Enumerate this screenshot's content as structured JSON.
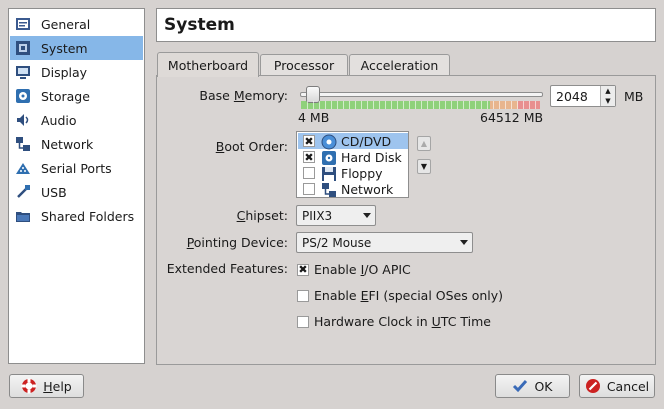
{
  "sidebar": {
    "items": [
      {
        "label": "General",
        "icon": "general-icon"
      },
      {
        "label": "System",
        "icon": "system-chip-icon",
        "selected": true
      },
      {
        "label": "Display",
        "icon": "display-monitor-icon"
      },
      {
        "label": "Storage",
        "icon": "storage-disk-icon"
      },
      {
        "label": "Audio",
        "icon": "audio-speaker-icon"
      },
      {
        "label": "Network",
        "icon": "network-icon"
      },
      {
        "label": "Serial Ports",
        "icon": "serial-port-icon"
      },
      {
        "label": "USB",
        "icon": "usb-icon"
      },
      {
        "label": "Shared Folders",
        "icon": "shared-folder-icon"
      }
    ]
  },
  "header": {
    "title": "System"
  },
  "tabs": [
    {
      "label": "Motherboard",
      "active": true
    },
    {
      "label": "Processor",
      "active": false
    },
    {
      "label": "Acceleration",
      "active": false
    }
  ],
  "motherboard": {
    "base_memory": {
      "label_pre": "Base ",
      "label_u": "M",
      "label_post": "emory:",
      "value": "2048",
      "unit": "MB",
      "min_label": "4 MB",
      "max_label": "64512 MB",
      "slider_fraction": 0.03
    },
    "boot_order": {
      "label_pre": "",
      "label_u": "B",
      "label_post": "oot Order:",
      "items": [
        {
          "label": "CD/DVD",
          "checked": true,
          "selected": true,
          "icon": "cd-dvd-icon"
        },
        {
          "label": "Hard Disk",
          "checked": true,
          "selected": false,
          "icon": "hard-disk-icon"
        },
        {
          "label": "Floppy",
          "checked": false,
          "selected": false,
          "icon": "floppy-icon"
        },
        {
          "label": "Network",
          "checked": false,
          "selected": false,
          "icon": "network-icon"
        }
      ]
    },
    "chipset": {
      "label_pre": "",
      "label_u": "C",
      "label_post": "hipset:",
      "value": "PIIX3"
    },
    "pointing_device": {
      "label_pre": "",
      "label_u": "P",
      "label_post": "ointing Device:",
      "value": "PS/2 Mouse"
    },
    "extended_features": {
      "label": "Extended Features:",
      "items": [
        {
          "pre": "Enable ",
          "u": "I",
          "post": "/O APIC",
          "checked": true
        },
        {
          "pre": "Enable ",
          "u": "E",
          "post": "FI (special OSes only)",
          "checked": false
        },
        {
          "pre": "Hardware Clock in ",
          "u": "U",
          "post": "TC Time",
          "checked": false
        }
      ]
    }
  },
  "buttons": {
    "help": {
      "pre": "",
      "u": "H",
      "post": "elp"
    },
    "ok": {
      "label": "OK"
    },
    "cancel": {
      "label": "Cancel"
    }
  },
  "colors": {
    "selection": "#86b7e8",
    "slider_green": "#8fd17b",
    "slider_orange": "#e8b58e",
    "slider_red": "#e88f8f",
    "cancel_red": "#cc2222",
    "ok_blue": "#3a6bb8"
  }
}
